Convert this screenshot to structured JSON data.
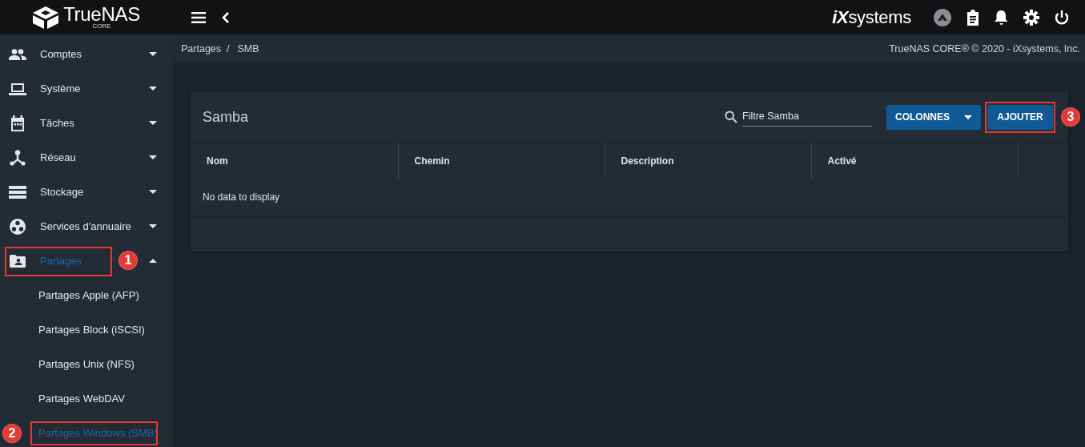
{
  "topbar": {
    "logo": "TrueNAS",
    "logo_sub": "CORE",
    "vendor": "**iX**systems"
  },
  "sidebar": {
    "items": [
      {
        "label": "Comptes",
        "expanded": false,
        "selected": false,
        "outlined": false
      },
      {
        "label": "Système",
        "expanded": false,
        "selected": false,
        "outlined": false
      },
      {
        "label": "Tâches",
        "expanded": false,
        "selected": false,
        "outlined": false
      },
      {
        "label": "Réseau",
        "expanded": false,
        "selected": false,
        "outlined": false
      },
      {
        "label": "Stockage",
        "expanded": false,
        "selected": false,
        "outlined": false
      },
      {
        "label": "Services d'annuaire",
        "expanded": false,
        "selected": false,
        "outlined": false
      },
      {
        "label": "Partages",
        "expanded": true,
        "selected": true,
        "outlined": true,
        "badge": "1",
        "children": [
          {
            "label": "Partages Apple (AFP)",
            "selected": false,
            "outlined": false
          },
          {
            "label": "Partages Block (iSCSI)",
            "selected": false,
            "outlined": false
          },
          {
            "label": "Partages Unix (NFS)",
            "selected": false,
            "outlined": false
          },
          {
            "label": "Partages WebDAV",
            "selected": false,
            "outlined": false
          },
          {
            "label": "Partages Windows (SMB)",
            "selected": true,
            "outlined": true,
            "badge": "2"
          }
        ]
      }
    ]
  },
  "breadcrumb": {
    "items": [
      "Partages",
      "SMB"
    ],
    "separator": "/",
    "copyright": "TrueNAS CORE® © 2020 - iXsystems, Inc."
  },
  "card": {
    "title": "Samba",
    "search": {
      "placeholder": "Filtre Samba"
    },
    "columns_button": "COLONNES",
    "add_button": {
      "label": "AJOUTER",
      "outlined": true,
      "badge": "3"
    },
    "table": {
      "columns": [
        "Nom",
        "Chemin",
        "Description",
        "Activé"
      ],
      "empty_message": "No data to display"
    }
  }
}
